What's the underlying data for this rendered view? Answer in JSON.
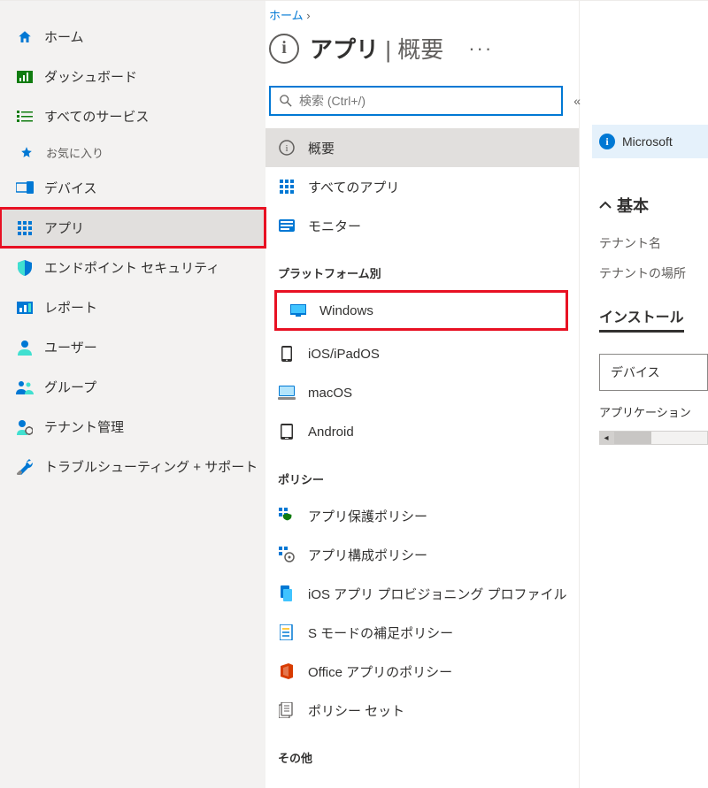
{
  "breadcrumb": {
    "level1": "ホーム",
    "sep": "›"
  },
  "blade_title": {
    "main": "アプリ",
    "sep": " | ",
    "sub": "概要"
  },
  "search": {
    "placeholder": "検索 (Ctrl+/)"
  },
  "info_banner": "Microsoft",
  "nav": {
    "home": "ホーム",
    "dashboard": "ダッシュボード",
    "all_services": "すべてのサービス",
    "favorites": "お気に入り",
    "devices": "デバイス",
    "apps": "アプリ",
    "endpoint_security": "エンドポイント セキュリティ",
    "reports": "レポート",
    "users": "ユーザー",
    "groups": "グループ",
    "tenant_admin": "テナント管理",
    "troubleshoot": "トラブルシューティング + サポート"
  },
  "menu": {
    "overview": "概要",
    "all_apps": "すべてのアプリ",
    "monitor": "モニター",
    "section_platform": "プラットフォーム別",
    "windows": "Windows",
    "ios": "iOS/iPadOS",
    "macos": "macOS",
    "android": "Android",
    "section_policy": "ポリシー",
    "app_protect": "アプリ保護ポリシー",
    "app_config": "アプリ構成ポリシー",
    "ios_prov": "iOS アプリ プロビジョニング プロファイル",
    "smode": "S モードの補足ポリシー",
    "office": "Office アプリのポリシー",
    "policy_set": "ポリシー セット",
    "section_other": "その他"
  },
  "detail": {
    "basic_header": "基本",
    "tenant_name_label": "テナント名",
    "tenant_loc_label": "テナントの場所",
    "install_header": "インストール",
    "device_select": "デバイス",
    "app_note": "アプリケーション"
  }
}
